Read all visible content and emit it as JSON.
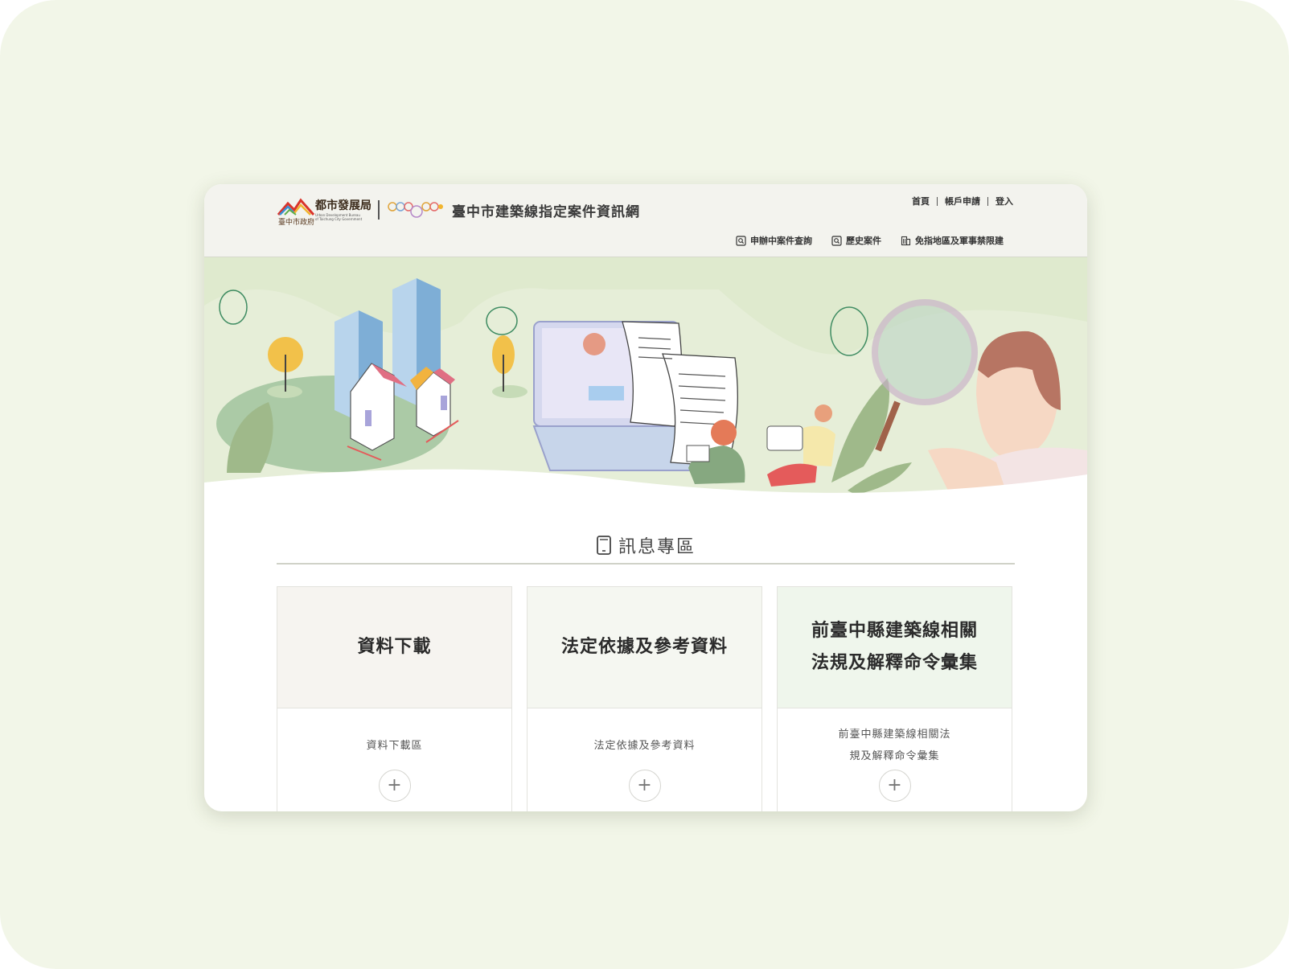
{
  "header": {
    "bureau_name": "都市發展局",
    "bureau_english": "Urban Development Bureau of Taichung City Government",
    "gov_name": "臺中市政府",
    "site_title": "臺中市建築線指定案件資訊網",
    "top_links": [
      "首頁",
      "帳戶申請",
      "登入"
    ],
    "sub_nav": [
      {
        "label": "申辦中案件查詢",
        "icon": "search-doc-icon"
      },
      {
        "label": "歷史案件",
        "icon": "search-doc-icon"
      },
      {
        "label": "免指地區及軍事禁限建",
        "icon": "building-icon"
      }
    ]
  },
  "section": {
    "title": "訊息專區",
    "icon": "tablet-icon"
  },
  "cards": [
    {
      "title_line1": "資料下載",
      "title_line2": "",
      "desc_line1": "資料下載區",
      "desc_line2": "",
      "bg": "#f6f4f0"
    },
    {
      "title_line1": "法定依據及參考資料",
      "title_line2": "",
      "desc_line1": "法定依據及參考資料",
      "desc_line2": "",
      "bg": "#f5f7f1"
    },
    {
      "title_line1": "前臺中縣建築線相關",
      "title_line2": "法規及解釋命令彙集",
      "desc_line1": "前臺中縣建築線相關法",
      "desc_line2": "規及解釋命令彙集",
      "bg": "#eff6ec"
    }
  ],
  "colors": {
    "page_bg": "#f2f6e8",
    "header_bg": "#f3f3ee",
    "hero_bg": "#e6eed8",
    "accent_green": "#a8c89e"
  }
}
